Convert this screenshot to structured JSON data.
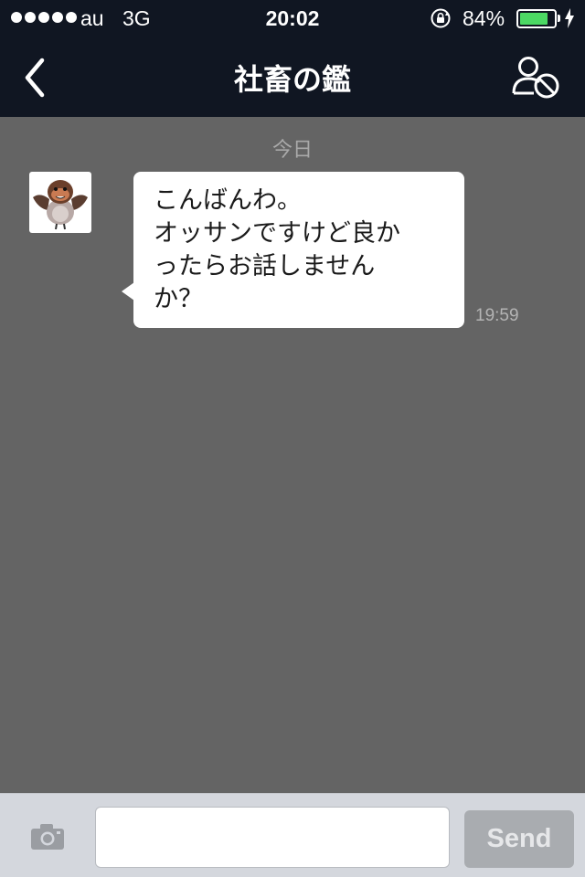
{
  "status_bar": {
    "carrier": "au",
    "network": "3G",
    "time": "20:02",
    "battery_percent": "84%",
    "battery_level": 0.84,
    "signal_bars": 5
  },
  "nav": {
    "title": "社畜の鑑",
    "back_icon": "chevron-left-icon",
    "block_icon": "user-block-icon"
  },
  "chat": {
    "date_separator": "今日",
    "messages": [
      {
        "sender_avatar": "bird-character-avatar",
        "lines": [
          "こんばんわ。",
          "オッサンですけど良か",
          "ったらお話しません",
          "か？"
        ],
        "time": "19:59"
      }
    ]
  },
  "input_bar": {
    "camera_icon": "camera-icon",
    "placeholder": "",
    "value": "",
    "send_label": "Send"
  },
  "colors": {
    "header_bg": "#101622",
    "chat_bg": "#646464",
    "bubble_bg": "#ffffff",
    "input_bar_bg": "#d4d7dd",
    "send_disabled": "#a9acb0",
    "battery_green": "#4cd964"
  }
}
